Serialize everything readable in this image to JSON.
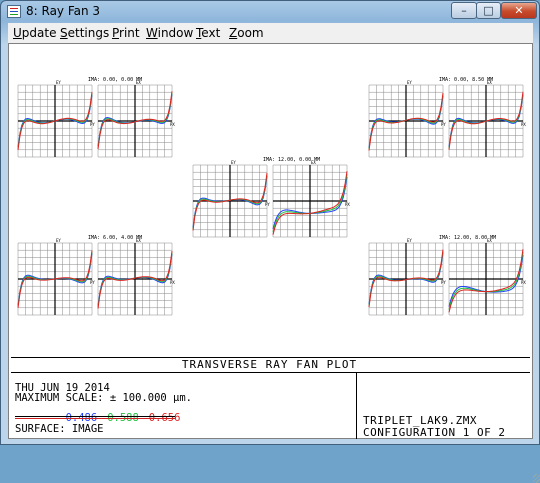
{
  "window": {
    "title": "8: Ray Fan 3",
    "buttons": {
      "minimize": "–",
      "maximize": "□",
      "close": "✕"
    }
  },
  "menu": [
    {
      "label": "Update",
      "underline": "U",
      "rest": "pdate"
    },
    {
      "label": "Settings",
      "underline": "S",
      "rest": "ettings"
    },
    {
      "label": "Print",
      "underline": "P",
      "rest": "rint"
    },
    {
      "label": "Window",
      "underline": "W",
      "rest": "indow"
    },
    {
      "label": "Text",
      "underline": "T",
      "rest": "ext"
    },
    {
      "label": "Zoom",
      "underline": "Z",
      "rest": "oom"
    }
  ],
  "plot": {
    "title": "TRANSVERSE RAY FAN PLOT",
    "date": "THU JUN 19 2014",
    "max_scale": "MAXIMUM SCALE: ± 100.000 µm.",
    "wavelengths": [
      {
        "value": "0.486",
        "color": "#2040ff"
      },
      {
        "value": "0.588",
        "color": "#20c040"
      },
      {
        "value": "0.656",
        "color": "#e02020"
      }
    ],
    "surface": "SURFACE: IMAGE",
    "file": "TRIPLET_LAK9.ZMX",
    "configuration": "CONFIGURATION 1 OF 2",
    "fields": [
      {
        "label": "IMA: 0.00, 0.00 MM",
        "pos": "top-left"
      },
      {
        "label": "IMA: 0.00, 8.50 MM",
        "pos": "top-right"
      },
      {
        "label": "IMA: 12.00, 0.00 MM",
        "pos": "center"
      },
      {
        "label": "IMA: 6.00, 4.00 MM",
        "pos": "bottom-left"
      },
      {
        "label": "IMA: 12.00, 8.00 MM",
        "pos": "bottom-right"
      }
    ],
    "axis_labels": {
      "y": "EY",
      "x": "PY",
      "y2": "EX",
      "x2": "PX"
    }
  }
}
